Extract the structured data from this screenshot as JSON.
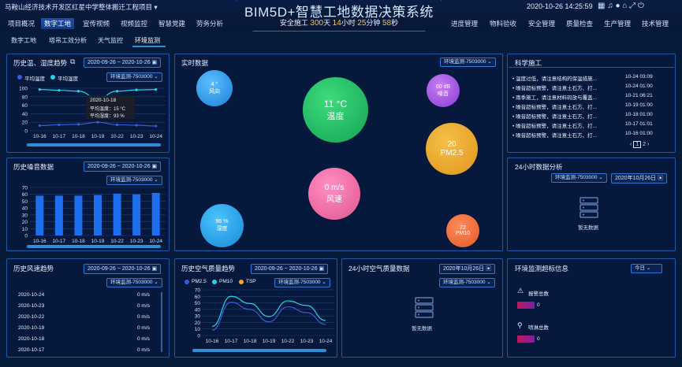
{
  "header": {
    "project": "马鞍山经济技术开发区红星中学整体搬迁工程项目",
    "title": "BIM5D+智慧工地数据决策系统",
    "datetime": "2020-10-26 14:25:59",
    "safe_prefix": "安全施工",
    "safe_days": "300",
    "u_day": "天",
    "safe_hours": "14",
    "u_hour": "小时",
    "safe_min": "25",
    "u_min": "分钟",
    "safe_sec": "58",
    "u_sec": "秒",
    "nav_left": [
      "项目概况",
      "数字工地",
      "宣传视频",
      "视频监控",
      "智慧党建",
      "劳务分析"
    ],
    "nav_right": [
      "进度管理",
      "物料验收",
      "安全管理",
      "质量检查",
      "生产管理",
      "技术管理"
    ],
    "subnav": [
      "数字工地",
      "塔吊工效分析",
      "天气监控",
      "环境监测"
    ]
  },
  "temp": {
    "title": "历史温、湿度趋势",
    "date": "2020-09-26 ~ 2020-10-26",
    "station": "环境监测-7503000",
    "legend": [
      "平均温度",
      "平均湿度"
    ],
    "tooltip": {
      "date": "2020-10-18",
      "t": "平均温度：15 °C",
      "h": "平均湿度：93 %"
    },
    "colors": {
      "temp": "#3b5bdb",
      "hum": "#22d3ee"
    }
  },
  "noise": {
    "title": "历史噪音数据",
    "date": "2020-09-26 ~ 2020-10-26",
    "station": "环境监测-7503000"
  },
  "wind": {
    "title": "历史风速趋势",
    "date": "2020-09-26 ~ 2020-10-26",
    "station": "环境监测-7503000",
    "rows": [
      {
        "d": "2020-10-24",
        "v": "0 m/s"
      },
      {
        "d": "2020-10-23",
        "v": "0 m/s"
      },
      {
        "d": "2020-10-22",
        "v": "0 m/s"
      },
      {
        "d": "2020-10-19",
        "v": "0 m/s"
      },
      {
        "d": "2020-10-18",
        "v": "0 m/s"
      },
      {
        "d": "2020-10-17",
        "v": "0 m/s"
      }
    ]
  },
  "realtime": {
    "title": "实时数据",
    "station": "环境监测-7503000",
    "b1v": "4 °",
    "b1l": "风向",
    "b2v": "11 °C",
    "b2l": "温度",
    "b3v": "60 dB",
    "b3l": "噪音",
    "b4v": "20",
    "b4l": "PM2.5",
    "b5v": "0 m/s",
    "b5l": "风速",
    "b6v": "96 %",
    "b6l": "湿度",
    "b7v": "22",
    "b7l": "PM10"
  },
  "air": {
    "title": "历史空气质量趋势",
    "date": "2020-09-26 ~ 2020-10-26",
    "station": "环境监测-7503000",
    "legend": [
      "PM2.5",
      "PM10",
      "TSP"
    ],
    "colors": {
      "pm25": "#3b5bdb",
      "pm10": "#22d3ee",
      "tsp": "#f4a62a"
    }
  },
  "air24": {
    "title": "24小时空气质量数据",
    "date": "2020年10月26日",
    "station": "环境监测-7503000",
    "nodata": "暂无数据"
  },
  "sci": {
    "title": "科学施工",
    "items": [
      {
        "t": "温度过低，请注意结构的保温措施...",
        "d": "10-24 03:09"
      },
      {
        "t": "噪音超标预警，请注意土石方、打...",
        "d": "10-24 01:00"
      },
      {
        "t": "雨季施工，请注意材料码放与覆盖...",
        "d": "10-21 06:21"
      },
      {
        "t": "噪音超标预警，请注意土石方、打...",
        "d": "10-19 01:00"
      },
      {
        "t": "噪音超标预警，请注意土石方、打...",
        "d": "10-18 01:00"
      },
      {
        "t": "噪音超标预警，请注意土石方、打...",
        "d": "10-17 01:01"
      },
      {
        "t": "噪音超标预警，请注意土石方、打...",
        "d": "10-16 01:00"
      }
    ],
    "p1": "1",
    "p2": "2"
  },
  "h24": {
    "title": "24小时数据分析",
    "station": "环境监测-7503000",
    "date": "2020年10月26日",
    "nodata": "暂无数据"
  },
  "alarm": {
    "title": "环境监测超标信息",
    "range": "今日",
    "a_label": "报警总数",
    "a_val": "0",
    "s_label": "喷淋总数",
    "s_val": "0"
  },
  "chart_data": [
    {
      "type": "line",
      "title": "历史温、湿度趋势",
      "x": [
        "10-16",
        "10-17",
        "10-18",
        "10-19",
        "10-22",
        "10-23",
        "10-24"
      ],
      "ylim": [
        0,
        100
      ],
      "yticks": [
        0,
        20,
        40,
        60,
        80,
        100
      ],
      "series": [
        {
          "name": "平均温度",
          "values": [
            12,
            14,
            15,
            20,
            14,
            13,
            11
          ]
        },
        {
          "name": "平均湿度",
          "values": [
            97,
            95,
            93,
            76,
            93,
            96,
            97
          ]
        }
      ]
    },
    {
      "type": "bar",
      "title": "历史噪音数据",
      "categories": [
        "10-16",
        "10-17",
        "10-18",
        "10-19",
        "10-22",
        "10-23",
        "10-24"
      ],
      "values": [
        58,
        58,
        58,
        59,
        61,
        60,
        62
      ],
      "ylim": [
        0,
        70
      ],
      "yticks": [
        0,
        10,
        20,
        30,
        40,
        50,
        60,
        70
      ]
    },
    {
      "type": "line",
      "title": "历史空气质量趋势",
      "x": [
        "10-16",
        "10-17",
        "10-18",
        "10-19",
        "10-22",
        "10-23",
        "10-24"
      ],
      "ylim": [
        0,
        70
      ],
      "yticks": [
        0,
        10,
        20,
        30,
        40,
        50,
        60,
        70
      ],
      "series": [
        {
          "name": "PM2.5",
          "values": [
            8,
            51,
            40,
            21,
            44,
            35,
            17
          ]
        },
        {
          "name": "PM10",
          "values": [
            14,
            60,
            49,
            29,
            53,
            46,
            23
          ]
        },
        {
          "name": "TSP",
          "values": [
            14,
            60,
            49,
            29,
            53,
            46,
            23
          ]
        }
      ]
    }
  ]
}
